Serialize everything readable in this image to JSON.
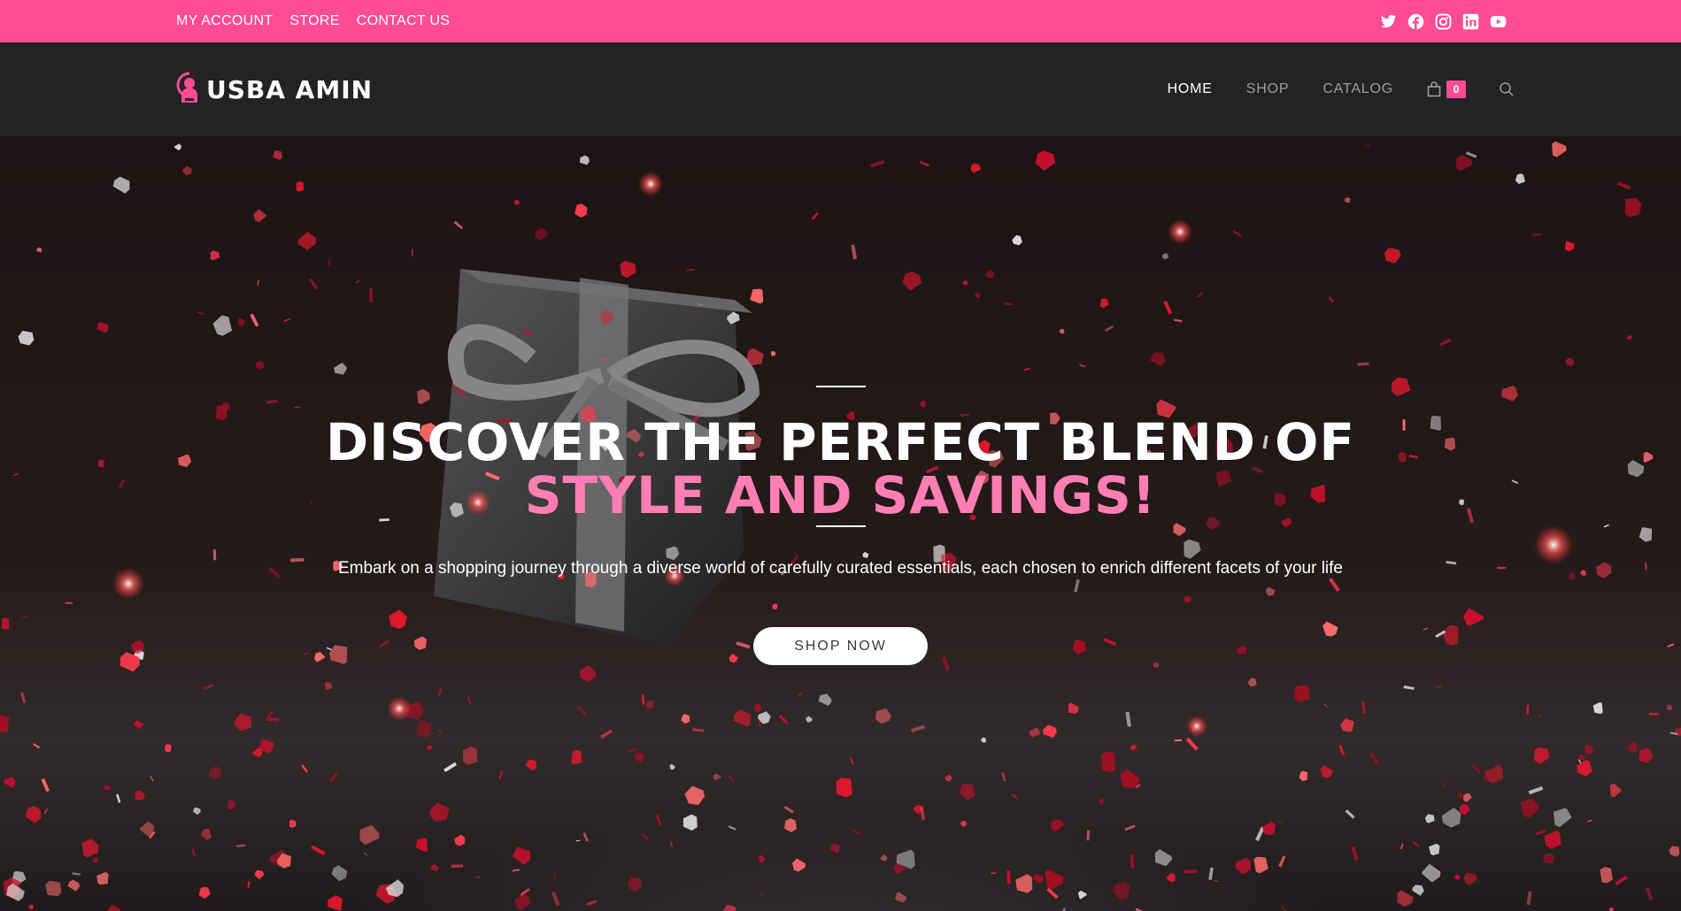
{
  "topbar": {
    "links": [
      "MY ACCOUNT",
      "STORE",
      "CONTACT US"
    ],
    "social_icons": [
      "twitter-icon",
      "facebook-icon",
      "instagram-icon",
      "linkedin-icon",
      "youtube-icon"
    ],
    "background_color": "#ff4c94"
  },
  "header": {
    "logo_text": "USBA AMIN",
    "nav": [
      "HOME",
      "SHOP",
      "CATALOG"
    ],
    "active_nav": "HOME",
    "cart_count": "0",
    "background_color": "#232323"
  },
  "hero": {
    "title_line1": "DISCOVER THE PERFECT BLEND OF",
    "title_line2": "STYLE AND SAVINGS!",
    "subtitle": "Embark on a shopping journey through a diverse world of carefully curated essentials, each chosen to enrich different facets of your life",
    "cta_label": "SHOP NOW",
    "accent_color": "#ff7fb3"
  }
}
